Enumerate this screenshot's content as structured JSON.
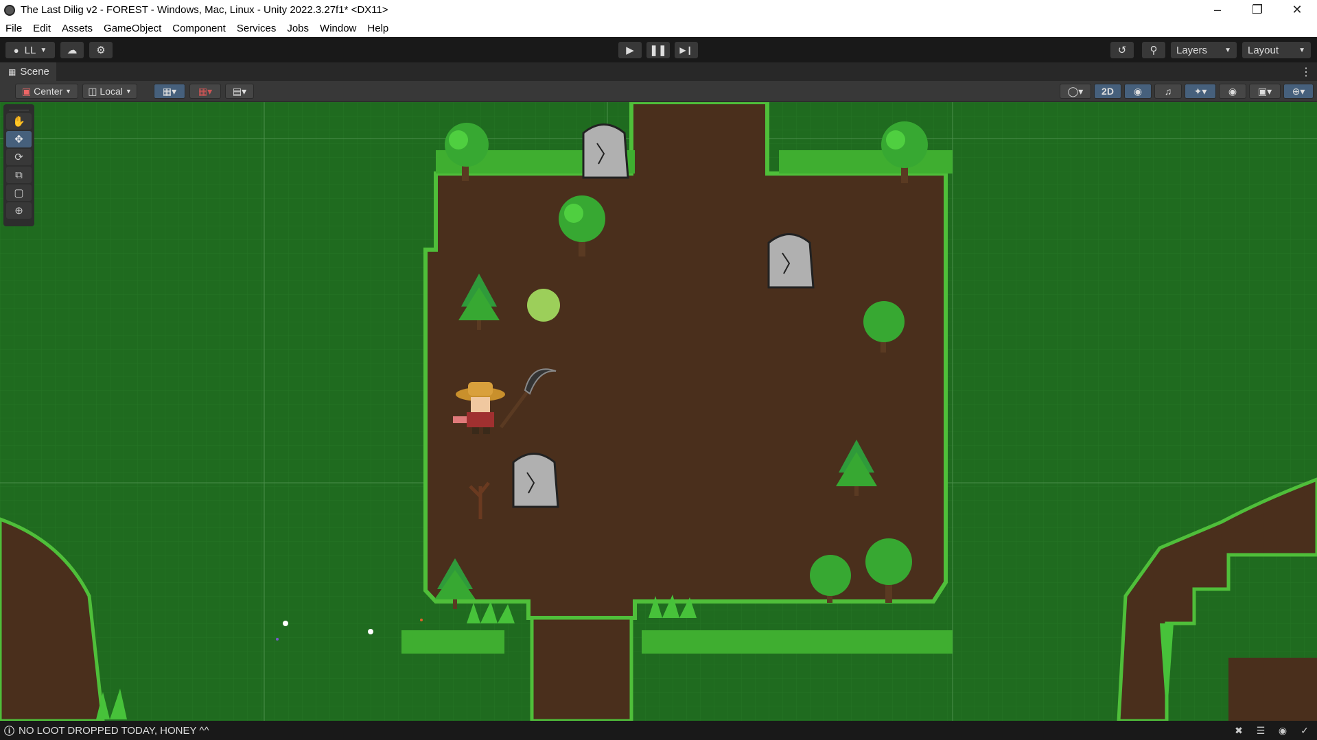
{
  "window": {
    "title": "The Last Dilig v2 - FOREST - Windows, Mac, Linux - Unity 2022.3.27f1* <DX11>"
  },
  "menu": [
    "File",
    "Edit",
    "Assets",
    "GameObject",
    "Component",
    "Services",
    "Jobs",
    "Window",
    "Help"
  ],
  "toolbar": {
    "account_label": "LL",
    "layers_label": "Layers",
    "layout_label": "Layout"
  },
  "scene": {
    "tab_label": "Scene",
    "pivot_label": "Center",
    "space_label": "Local",
    "mode_2d_label": "2D"
  },
  "status": {
    "message": "NO LOOT DROPPED TODAY, HONEY ^^"
  },
  "icons": [
    "unity-icon",
    "minimize-icon",
    "restore-icon",
    "close-icon",
    "account-icon",
    "cloud-icon",
    "settings-icon",
    "play-icon",
    "pause-icon",
    "step-icon",
    "history-icon",
    "search-icon",
    "hand-tool-icon",
    "move-tool-icon",
    "rotate-tool-icon",
    "scale-tool-icon",
    "rect-tool-icon",
    "transform-tool-icon"
  ],
  "colors": {
    "grass": "#1f6b1f",
    "grass_light": "#4fbf3a",
    "dirt": "#4a2f1c",
    "toolbar_bg": "#191919",
    "panel_bg": "#383838",
    "active_blue": "#46607c"
  }
}
